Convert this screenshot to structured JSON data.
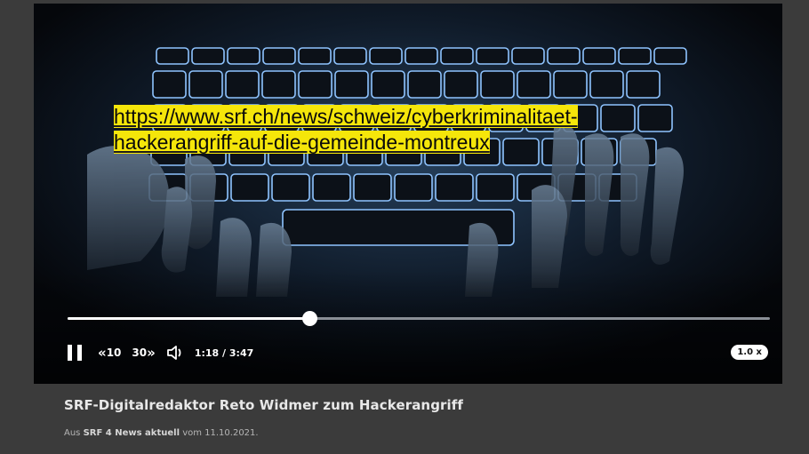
{
  "overlay": {
    "url_line1": "https://www.srf.ch/news/schweiz/cyberkriminalitaet-",
    "url_line2": "hackerangriff-auf-die-gemeinde-montreux"
  },
  "player": {
    "progress_fraction": 0.344,
    "rewind_label": "10",
    "forward_label": "30",
    "time_current": "1:18",
    "time_separator": "/",
    "time_total": "3:47",
    "speed_label": "1.0 x",
    "icons": [
      "pause-icon",
      "rewind-10-icon",
      "forward-30-icon",
      "volume-icon"
    ]
  },
  "caption": {
    "title": "SRF-Digitalredaktor Reto Widmer zum Hackerangriff",
    "meta_prefix": "Aus",
    "meta_show": "SRF 4 News aktuell",
    "meta_suffix": "vom 11.10.2021."
  },
  "colors": {
    "page_bg": "#3b3b3b",
    "video_bg": "#0b0f16",
    "link_highlight": "#f5e60a",
    "key_glow": "#8fc4ff"
  }
}
